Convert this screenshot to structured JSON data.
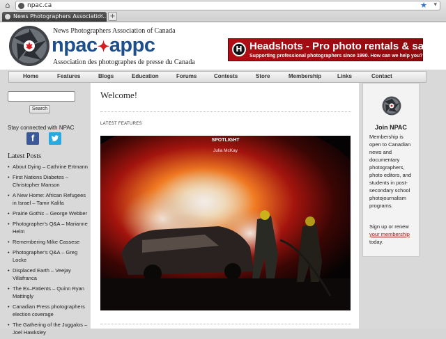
{
  "browser": {
    "url": "npac.ca",
    "tab_title": "News Photographers Associatio...",
    "tab_close": "×",
    "new_tab": "+",
    "star": "★",
    "menu_arrow": "▾",
    "home": "⌂"
  },
  "header": {
    "org_name_en": "News Photographers Association of Canada",
    "abbr_left": "npac",
    "abbr_leaf": "✦",
    "abbr_right": "appc",
    "org_name_fr": "Association des photographes de presse du Canada",
    "ad": {
      "logo": "H",
      "headline": "Headshots - Pro photo rentals & sales",
      "tagline": "Supporting professional photographers since 1990. How can we help you?"
    }
  },
  "nav": {
    "items": [
      "Home",
      "Features",
      "Blogs",
      "Education",
      "Forums",
      "Contests",
      "Store",
      "Membership",
      "Links",
      "Contact"
    ]
  },
  "sidebar": {
    "search_button": "Search",
    "search_value": "",
    "stay_connected": "Stay connected with NPAC",
    "facebook_letter": "f",
    "latest_heading": "Latest Posts",
    "posts": [
      "About Dying – Cathrine Ertmann",
      "First Nations Diabetes – Christopher Manson",
      "A New Home: African Refugees in Israel – Tamir Kalifa",
      "Prairie Gothic – George Webber",
      "Photographer's Q&A – Marianne Helm",
      "Remembering Mike Cassese",
      "Photographer's Q&A – Greg Locke",
      "Displaced Earth – Veejay Villafranca",
      "The Ex–Patients – Quinn Ryan Mattingly",
      "Canadian Press photographers election coverage",
      "The Gathering of the Juggalos – Joel Hawksley"
    ]
  },
  "main": {
    "title": "Welcome!",
    "latest_features": "LATEST FEATURES",
    "feature": {
      "label": "SPOTLIGHT",
      "byline": "Julia McKay"
    }
  },
  "join": {
    "title": "Join NPAC",
    "body": "Membership is open to Canadian news and documentary photographers, photo editors, and students in post-secondary school photojournalism programs.",
    "signup_prefix": "Sign up or renew",
    "signup_link": "your membership",
    "signup_suffix": "today."
  },
  "colors": {
    "brand_blue": "#1f4e8c",
    "brand_red": "#d21f26",
    "ad_red": "#b00e14",
    "link_red": "#a11818"
  },
  "icons": [
    "home-icon",
    "site-favicon",
    "bookmark-star-icon",
    "camera-aperture-icon",
    "facebook-icon",
    "twitter-icon"
  ]
}
